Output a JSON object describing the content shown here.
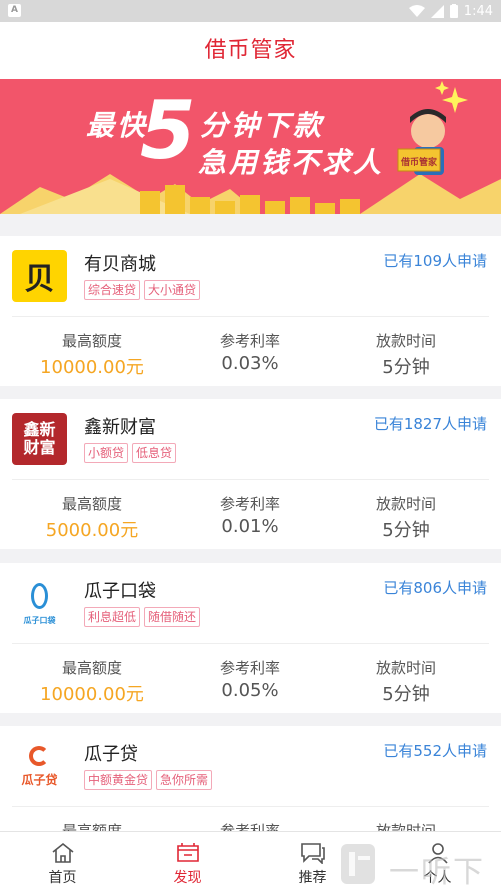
{
  "status": {
    "time": "1:44"
  },
  "header": {
    "title": "借币管家"
  },
  "banner": {
    "line1": "最快",
    "line1b": "分钟下款",
    "big": "5",
    "line2": "急用钱不求人",
    "badge": "借币管家"
  },
  "products": [
    {
      "name": "有贝商城",
      "applied": "已有109人申请",
      "tags": [
        "综合速贷",
        "大小通贷"
      ],
      "max_label": "最高额度",
      "max": "10000.00元",
      "rate_label": "参考利率",
      "rate": "0.03%",
      "time_label": "放款时间",
      "time": "5分钟",
      "logo_text": "贝",
      "logo_bg": "#ffd400",
      "logo_fg": "#222"
    },
    {
      "name": "鑫新财富",
      "applied": "已有1827人申请",
      "tags": [
        "小额贷",
        "低息贷"
      ],
      "max_label": "最高额度",
      "max": "5000.00元",
      "rate_label": "参考利率",
      "rate": "0.01%",
      "time_label": "放款时间",
      "time": "5分钟",
      "logo_text": "鑫新财富",
      "logo_bg": "#b3282c",
      "logo_fg": "#fff"
    },
    {
      "name": "瓜子口袋",
      "applied": "已有806人申请",
      "tags": [
        "利息超低",
        "随借随还"
      ],
      "max_label": "最高额度",
      "max": "10000.00元",
      "rate_label": "参考利率",
      "rate": "0.05%",
      "time_label": "放款时间",
      "time": "5分钟",
      "logo_text": "瓜子口袋",
      "logo_bg": "#ffffff",
      "logo_fg": "#2a8fd6"
    },
    {
      "name": "瓜子贷",
      "applied": "已有552人申请",
      "tags": [
        "中额黄金贷",
        "急你所需"
      ],
      "max_label": "最高额度",
      "max": "",
      "rate_label": "参考利率",
      "rate": "",
      "time_label": "放款时间",
      "time": "",
      "logo_text": "瓜子贷",
      "logo_bg": "#ffffff",
      "logo_fg": "#e8582a"
    }
  ],
  "tabs": [
    {
      "label": "首页",
      "icon": "home-icon"
    },
    {
      "label": "发现",
      "icon": "discover-icon"
    },
    {
      "label": "推荐",
      "icon": "chat-icon"
    },
    {
      "label": "个人",
      "icon": "user-icon"
    }
  ],
  "watermark": {
    "text": "一听下载"
  },
  "colors": {
    "accent": "#e02735",
    "banner": "#f2556a",
    "link": "#3a84d8",
    "amount": "#f5a623",
    "tag": "#e5607a"
  }
}
